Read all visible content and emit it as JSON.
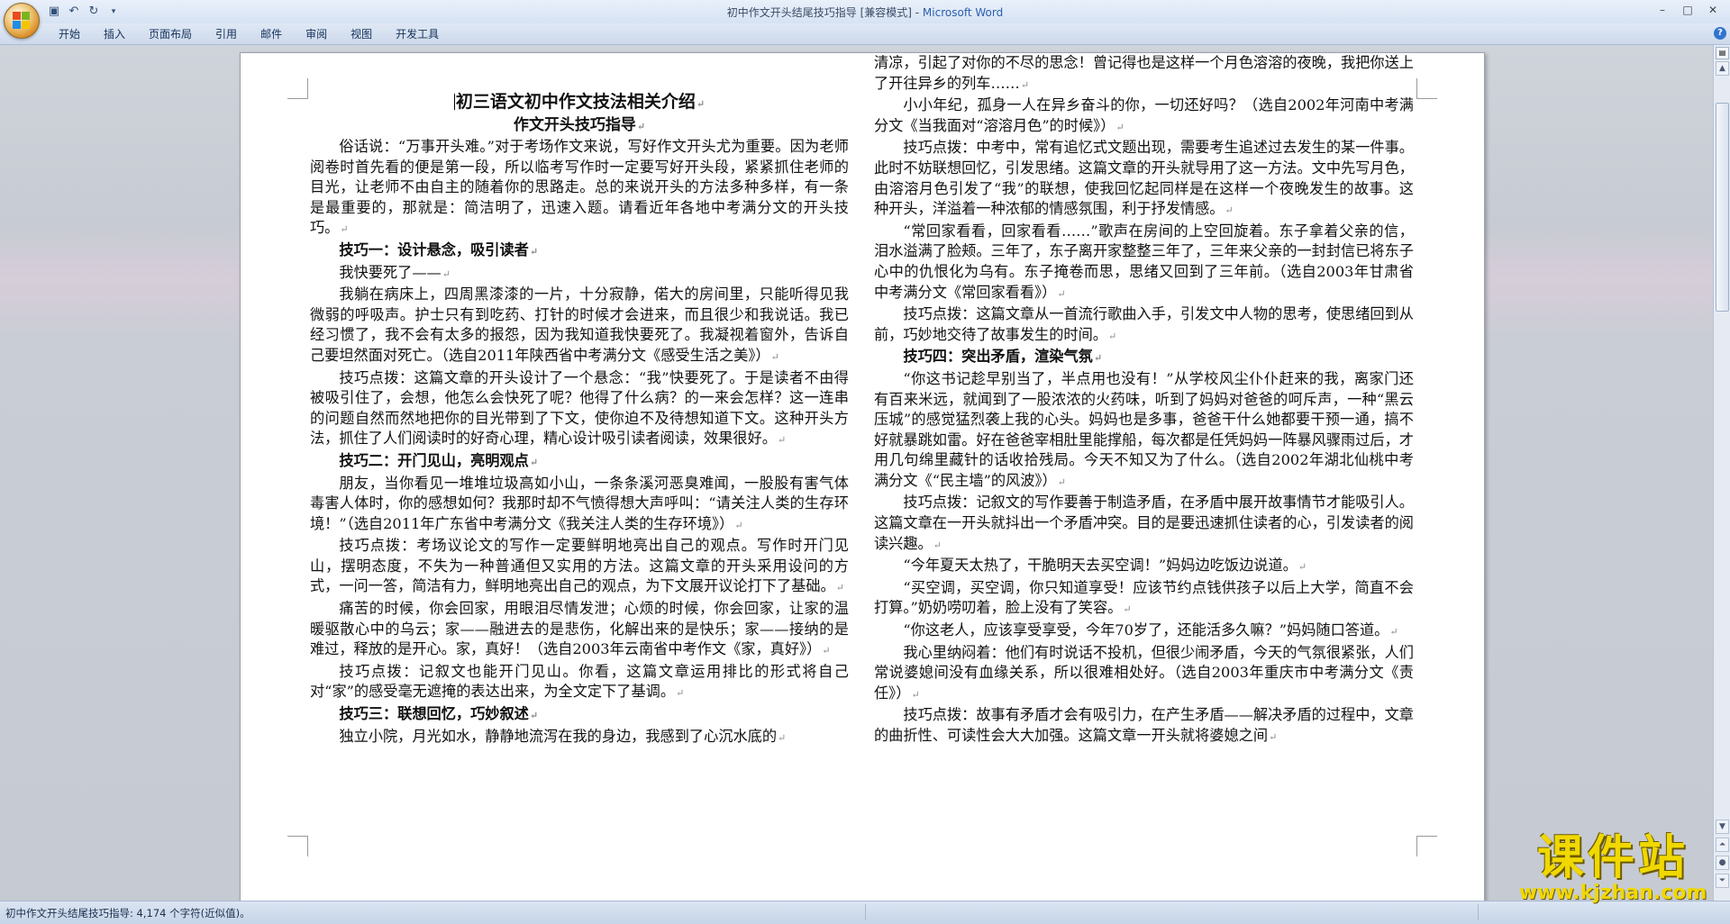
{
  "window": {
    "doc_title": "初中作文开头结尾技巧指导 [兼容模式] - ",
    "app_name": "Microsoft Word",
    "controls": [
      "–",
      "□",
      "✕"
    ]
  },
  "ribbon": {
    "tabs": [
      "开始",
      "插入",
      "页面布局",
      "引用",
      "邮件",
      "审阅",
      "视图",
      "开发工具"
    ]
  },
  "document": {
    "title": "初三语文初中作文技法相关介绍",
    "subtitle": "作文开头技巧指导",
    "left_column": [
      {
        "text": "俗话说：“万事开头难。”对于考场作文来说，写好作文开头尤为重要。因为老师阅卷时首先看的便是第一段，所以临考写作时一定要写好开头段，紧紧抓住老师的目光，让老师不由自主的随着你的思路走。总的来说开头的方法多种多样，有一条是最重要的，那就是：简洁明了，迅速入题。请看近年各地中考满分文的开头技巧。",
        "heading": false
      },
      {
        "text": "技巧一：设计悬念，吸引读者",
        "heading": true
      },
      {
        "text": "我快要死了——",
        "heading": false
      },
      {
        "text": "我躺在病床上，四周黑漆漆的一片，十分寂静，偌大的房间里，只能听得见我微弱的呼吸声。护士只有到吃药、打针的时候才会进来，而且很少和我说话。我已经习惯了，我不会有太多的报怨，因为我知道我快要死了。我凝视着窗外，告诉自己要坦然面对死亡。（选自2011年陕西省中考满分文《感受生活之美》）",
        "heading": false
      },
      {
        "text": "技巧点拨：这篇文章的开头设计了一个悬念：“我”快要死了。于是读者不由得被吸引住了，会想，他怎么会快死了呢？他得了什么病？的一来会怎样？这一连串的问题自然而然地把你的目光带到了下文，使你迫不及待想知道下文。这种开头方法，抓住了人们阅读时的好奇心理，精心设计吸引读者阅读，效果很好。",
        "heading": false
      },
      {
        "text": "技巧二：开门见山，亮明观点",
        "heading": true
      },
      {
        "text": "朋友，当你看见一堆堆垃圾高如小山，一条条溪河恶臭难闻，一股股有害气体毒害人体时，你的感想如何？我那时却不气愤得想大声呼叫：“请关注人类的生存环境！”（选自2011年广东省中考满分文《我关注人类的生存环境》）",
        "heading": false
      },
      {
        "text": "技巧点拨：考场议论文的写作一定要鲜明地亮出自己的观点。写作时开门见山，摆明态度，不失为一种普通但又实用的方法。这篇文章的开头采用设问的方式，一问一答，简洁有力，鲜明地亮出自己的观点，为下文展开议论打下了基础。",
        "heading": false
      },
      {
        "text": "痛苦的时候，你会回家，用眼泪尽情发泄；心烦的时候，你会回家，让家的温暖驱散心中的乌云；家——融进去的是悲伤，化解出来的是快乐；家——接纳的是难过，释放的是开心。家，真好！（选自2003年云南省中考作文《家，真好》）",
        "heading": false
      },
      {
        "text": "技巧点拨：记叙文也能开门见山。你看，这篇文章运用排比的形式将自己对“家”的感受毫无遮掩的表达出来，为全文定下了基调。",
        "heading": false
      },
      {
        "text": "技巧三：联想回忆，巧妙叙述",
        "heading": true
      },
      {
        "text": "独立小院，月光如水，静静地流泻在我的身边，我感到了心沉水底的",
        "heading": false
      }
    ],
    "right_column": [
      {
        "text": "清凉，引起了对你的不尽的思念！曾记得也是这样一个月色溶溶的夜晚，我把你送上了开往异乡的列车……",
        "heading": false,
        "cont": true
      },
      {
        "text": "小小年纪，孤身一人在异乡奋斗的你，一切还好吗？（选自2002年河南中考满分文《当我面对“溶溶月色”的时候》）",
        "heading": false
      },
      {
        "text": "技巧点拨：中考中，常有追忆式文题出现，需要考生追述过去发生的某一件事。此时不妨联想回忆，引发思绪。这篇文章的开头就导用了这一方法。文中先写月色，由溶溶月色引发了“我”的联想，使我回忆起同样是在这样一个夜晚发生的故事。这种开头，洋溢着一种浓郁的情感氛围，利于抒发情感。",
        "heading": false
      },
      {
        "text": "“常回家看看，回家看看……”歌声在房间的上空回旋着。东子拿着父亲的信，泪水溢满了脸颊。三年了，东子离开家整整三年了，三年来父亲的一封封信已将东子心中的仇恨化为乌有。东子掩卷而思，思绪又回到了三年前。（选自2003年甘肃省中考满分文《常回家看看》）",
        "heading": false
      },
      {
        "text": "技巧点拨：这篇文章从一首流行歌曲入手，引发文中人物的思考，使思绪回到从前，巧妙地交待了故事发生的时间。",
        "heading": false
      },
      {
        "text": "技巧四：突出矛盾，渲染气氛",
        "heading": true
      },
      {
        "text": "“你这书记趁早别当了，半点用也没有！”从学校风尘仆仆赶来的我，离家门还有百来米远，就闻到了一股浓浓的火药味，听到了妈妈对爸爸的呵斥声，一种“黑云压城”的感觉猛烈袭上我的心头。妈妈也是多事，爸爸干什么她都要干预一通，搞不好就暴跳如雷。好在爸爸宰相肚里能撑船，每次都是任凭妈妈一阵暴风骤雨过后，才用几句绵里藏针的话收拾残局。今天不知又为了什么。（选自2002年湖北仙桃中考满分文《“民主墙”的风波》）",
        "heading": false
      },
      {
        "text": "技巧点拨：记叙文的写作要善于制造矛盾，在矛盾中展开故事情节才能吸引人。这篇文章在一开头就抖出一个矛盾冲突。目的是要迅速抓住读者的心，引发读者的阅读兴趣。",
        "heading": false
      },
      {
        "text": "“今年夏天太热了，干脆明天去买空调！”妈妈边吃饭边说道。",
        "heading": false
      },
      {
        "text": "“买空调，买空调，你只知道享受！应该节约点钱供孩子以后上大学，简直不会打算。”奶奶唠叨着，脸上没有了笑容。",
        "heading": false
      },
      {
        "text": "“你这老人，应该享受享受，今年70岁了，还能活多久嘛？”妈妈随口答道。",
        "heading": false
      },
      {
        "text": "我心里纳闷着：他们有时说话不投机，但很少闹矛盾，今天的气氛很紧张，人们常说婆媳间没有血缘关系，所以很难相处好。（选自2003年重庆市中考满分文《责任》）",
        "heading": false
      },
      {
        "text": "技巧点拨：故事有矛盾才会有吸引力，在产生矛盾——解决矛盾的过程中，文章的曲折性、可读性会大大加强。这篇文章一开头就将婆媳之间",
        "heading": false
      }
    ]
  },
  "status": {
    "text": "初中作文开头结尾技巧指导: 4,174 个字符(近似值)。"
  },
  "watermark": {
    "title": "课件站",
    "url": "www.kjzhan.com"
  },
  "colors": {
    "accent": "#2a5fb0",
    "watermark": "#f0d800"
  }
}
